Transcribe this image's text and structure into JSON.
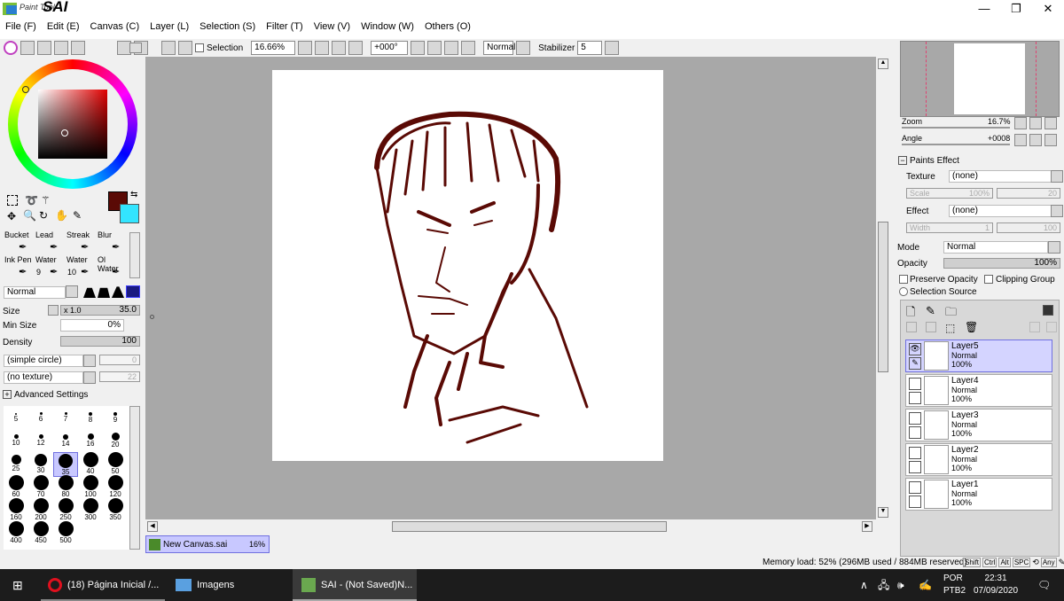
{
  "app": {
    "logo_small": "Paint Tool",
    "logo_big": "SAI"
  },
  "menu": [
    "File (F)",
    "Edit (E)",
    "Canvas (C)",
    "Layer (L)",
    "Selection (S)",
    "Filter (T)",
    "View (V)",
    "Window (W)",
    "Others (O)"
  ],
  "toolbar": {
    "selection_label": "Selection",
    "zoom": "16.66%",
    "angle": "+000°",
    "blend": "Normal",
    "stabilizer_label": "Stabilizer",
    "stabilizer_value": "5"
  },
  "colors": {
    "primary": "#5a0a05",
    "secondary": "#33e5ff",
    "canvas_bg": "#a8a8a8"
  },
  "tools": [
    {
      "name": "Bucket",
      "sub": ""
    },
    {
      "name": "Lead",
      "sub": ""
    },
    {
      "name": "Streak",
      "sub": ""
    },
    {
      "name": "Blur",
      "sub": ""
    },
    {
      "name": "Ink Pen",
      "sub": ""
    },
    {
      "name": "Water",
      "sub": "9"
    },
    {
      "name": "Water",
      "sub": "10"
    },
    {
      "name": "Ol Water",
      "sub": ""
    }
  ],
  "brush": {
    "mode": "Normal",
    "size_label": "Size",
    "size_mult": "x 1.0",
    "size_value": "35.0",
    "min_size_label": "Min Size",
    "min_size_value": "0%",
    "density_label": "Density",
    "density_value": "100",
    "shape": "(simple circle)",
    "shape_value": "0",
    "texture": "(no texture)",
    "texture_value": "22",
    "advanced_label": "Advanced Settings"
  },
  "brush_sizes": [
    "5",
    "6",
    "7",
    "8",
    "9",
    "10",
    "12",
    "14",
    "16",
    "20",
    "25",
    "30",
    "35",
    "40",
    "50",
    "60",
    "70",
    "80",
    "100",
    "120",
    "160",
    "200",
    "250",
    "300",
    "350",
    "400",
    "450",
    "500"
  ],
  "brush_selected": "35",
  "navigator": {
    "zoom_label": "Zoom",
    "zoom_value": "16.7%",
    "angle_label": "Angle",
    "angle_value": "+0008"
  },
  "paints_effect": {
    "title": "Paints Effect",
    "texture_label": "Texture",
    "texture_value": "(none)",
    "scale_label": "Scale",
    "scale_value": "100%",
    "scale_num": "20",
    "effect_label": "Effect",
    "effect_value": "(none)",
    "width_label": "Width",
    "width_value": "1",
    "width_num": "100"
  },
  "layer_props": {
    "mode_label": "Mode",
    "mode_value": "Normal",
    "opacity_label": "Opacity",
    "opacity_value": "100%",
    "preserve": "Preserve Opacity",
    "clipping": "Clipping Group",
    "selection_source": "Selection Source"
  },
  "layers": [
    {
      "name": "Layer5",
      "mode": "Normal",
      "opacity": "100%"
    },
    {
      "name": "Layer4",
      "mode": "Normal",
      "opacity": "100%"
    },
    {
      "name": "Layer3",
      "mode": "Normal",
      "opacity": "100%"
    },
    {
      "name": "Layer2",
      "mode": "Normal",
      "opacity": "100%"
    },
    {
      "name": "Layer1",
      "mode": "Normal",
      "opacity": "100%"
    }
  ],
  "doc_tab": {
    "name": "New Canvas.sai",
    "zoom": "16%"
  },
  "status": {
    "memory": "Memory load: 52% (296MB used / 884MB reserved)",
    "keys": [
      "Shift",
      "Ctrl",
      "Alt",
      "SPC",
      "Any"
    ]
  },
  "taskbar": {
    "tasks": [
      "(18) Página Inicial /...",
      "Imagens",
      "SAI - (Not Saved)N..."
    ],
    "lang1": "POR",
    "lang2": "PTB2",
    "time": "22:31",
    "date": "07/09/2020"
  }
}
